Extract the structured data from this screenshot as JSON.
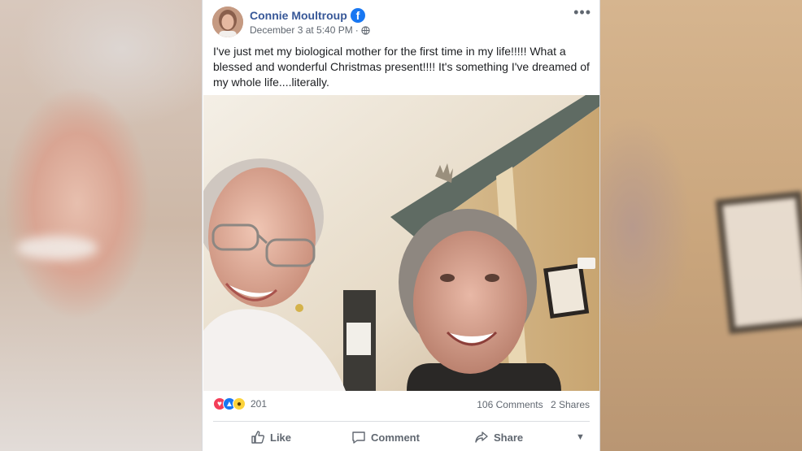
{
  "post": {
    "author": "Connie Moultroup",
    "timestamp": "December 3 at 5:40 PM",
    "separator": "·",
    "text": "I've just met my biological mother for the first time in my life!!!!! What a blessed and wonderful Christmas present!!!! It's something I've dreamed of my whole life....literally.",
    "badge_letter": "f",
    "more_icon": "•••"
  },
  "stats": {
    "reaction_count": "201",
    "comments": "106 Comments",
    "shares": "2 Shares",
    "reaction_types": [
      "love",
      "like",
      "wow"
    ]
  },
  "actions": {
    "like": "Like",
    "comment": "Comment",
    "share": "Share",
    "menu_caret": "▼"
  },
  "colors": {
    "author_link": "#385898",
    "facebook_blue": "#1877f2",
    "love": "#f33e58",
    "wow": "#fcd33b",
    "muted_text": "#606770"
  }
}
